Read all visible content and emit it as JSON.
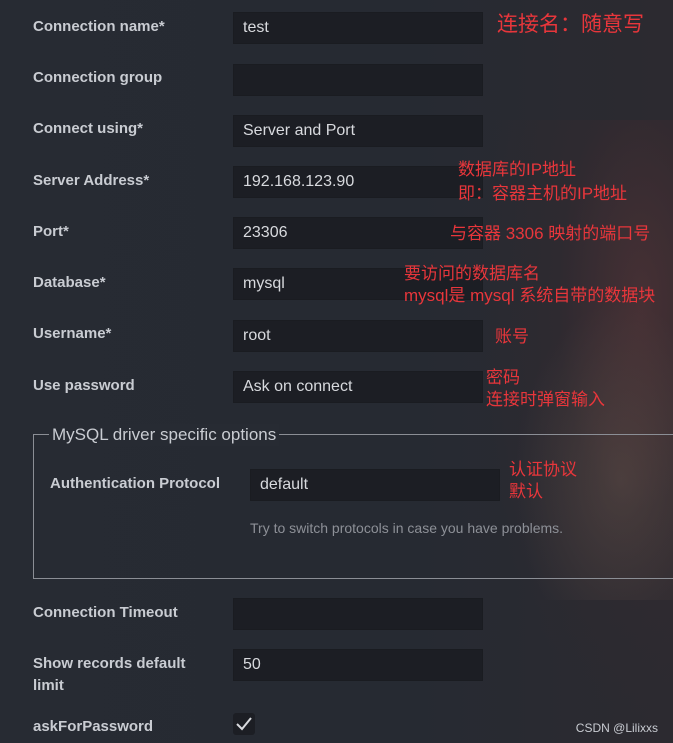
{
  "form": {
    "connection_name": {
      "label": "Connection name*",
      "value": "test"
    },
    "connection_group": {
      "label": "Connection group",
      "value": ""
    },
    "connect_using": {
      "label": "Connect using*",
      "value": "Server and Port"
    },
    "server_address": {
      "label": "Server Address*",
      "value": "192.168.123.90"
    },
    "port": {
      "label": "Port*",
      "value": "23306"
    },
    "database": {
      "label": "Database*",
      "value": "mysql"
    },
    "username": {
      "label": "Username*",
      "value": "root"
    },
    "use_password": {
      "label": "Use password",
      "value": "Ask on connect"
    },
    "driver_group": {
      "legend": "MySQL driver specific options",
      "auth_protocol": {
        "label": "Authentication Protocol",
        "value": "default"
      },
      "hint": "Try to switch protocols in case you have problems."
    },
    "connection_timeout": {
      "label": "Connection Timeout",
      "value": ""
    },
    "show_records_limit": {
      "label": "Show records default\nlimit",
      "value": "50"
    },
    "ask_for_password": {
      "label": "askForPassword",
      "checked": true
    }
  },
  "annotations": {
    "name_note": "连接名：随意写",
    "server_note": "数据库的IP地址\n即：容器主机的IP地址",
    "port_note": "与容器 3306 映射的端口号",
    "database_note": "要访问的数据库名\nmysql是 mysql 系统自带的数据块",
    "username_note": "账号",
    "password_note": "密码\n连接时弹窗输入",
    "auth_note": "认证协议\n默认"
  },
  "watermark": "CSDN @Lilixxs",
  "colors": {
    "background": "#262a33",
    "field_bg": "#1c1e24",
    "label": "#c9ccd2",
    "annotation": "#e8363b"
  }
}
